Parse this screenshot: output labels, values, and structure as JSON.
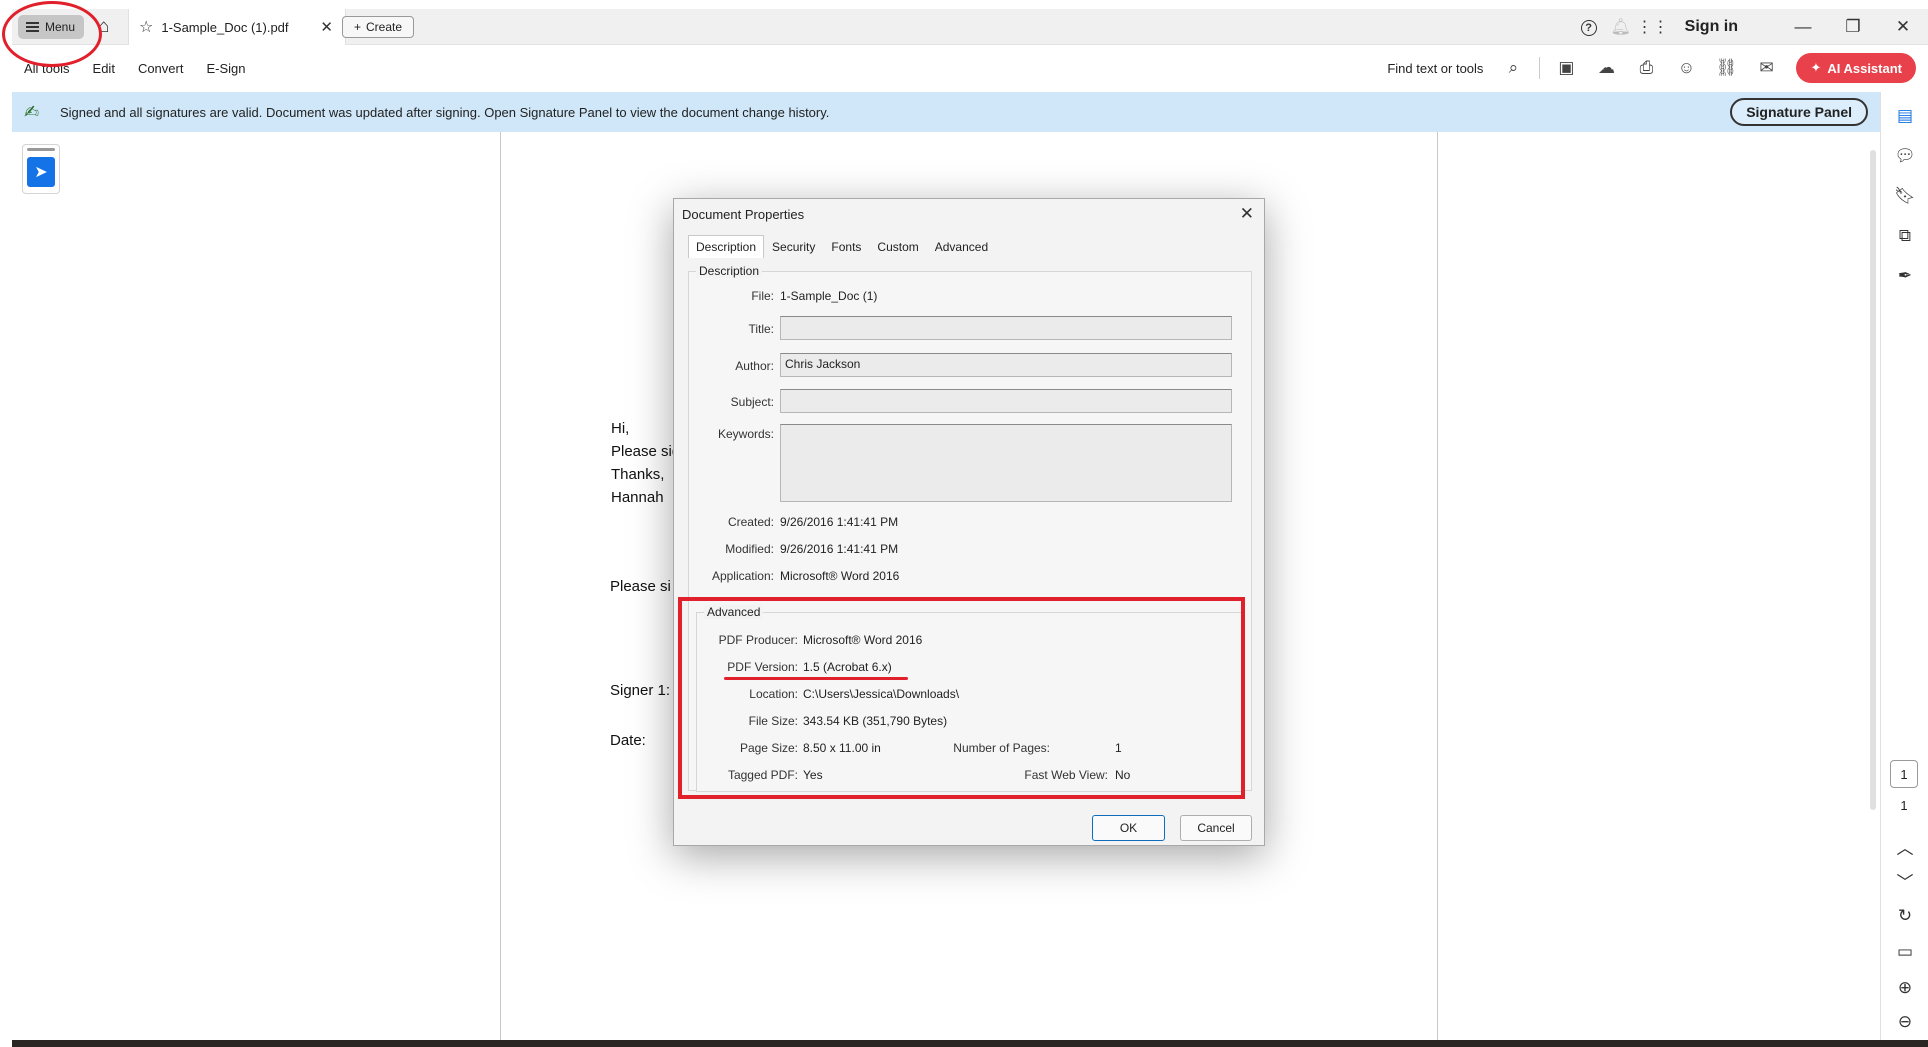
{
  "titlebar": {
    "menu_label": "Menu",
    "tab_title": "1-Sample_Doc (1).pdf",
    "create_label": "Create",
    "sign_in": "Sign in"
  },
  "toolbar": {
    "menu_items": [
      "All tools",
      "Edit",
      "Convert",
      "E-Sign"
    ],
    "find_label": "Find text or tools",
    "ai_assistant": "AI Assistant"
  },
  "banner": {
    "message": "Signed and all signatures are valid. Document was updated after signing. Open Signature Panel to view the document change history.",
    "button": "Signature Panel"
  },
  "document": {
    "lines": [
      "Hi,",
      "Please sig",
      "Thanks,",
      "Hannah"
    ],
    "please_sign": "Please si",
    "signer": "Signer 1:",
    "date": "Date:"
  },
  "dialog": {
    "title": "Document Properties",
    "tabs": [
      "Description",
      "Security",
      "Fonts",
      "Custom",
      "Advanced"
    ],
    "description_group": "Description",
    "file_label": "File:",
    "file_value": "1-Sample_Doc (1)",
    "title_label": "Title:",
    "title_value": "",
    "author_label": "Author:",
    "author_value": "Chris Jackson",
    "subject_label": "Subject:",
    "subject_value": "",
    "keywords_label": "Keywords:",
    "keywords_value": "",
    "created_label": "Created:",
    "created_value": "9/26/2016 1:41:41 PM",
    "modified_label": "Modified:",
    "modified_value": "9/26/2016 1:41:41 PM",
    "application_label": "Application:",
    "application_value": "Microsoft® Word 2016",
    "advanced_group": "Advanced",
    "producer_label": "PDF Producer:",
    "producer_value": "Microsoft® Word 2016",
    "version_label": "PDF Version:",
    "version_value": "1.5 (Acrobat 6.x)",
    "location_label": "Location:",
    "location_value": "C:\\Users\\Jessica\\Downloads\\",
    "filesize_label": "File Size:",
    "filesize_value": "343.54 KB (351,790 Bytes)",
    "pagesize_label": "Page Size:",
    "pagesize_value": "8.50 x 11.00 in",
    "numpages_label": "Number of Pages:",
    "numpages_value": "1",
    "tagged_label": "Tagged PDF:",
    "tagged_value": "Yes",
    "fastweb_label": "Fast Web View:",
    "fastweb_value": "No",
    "ok": "OK",
    "cancel": "Cancel"
  },
  "pagenav": {
    "current": "1",
    "total": "1"
  },
  "colors": {
    "accent": "#1473e6",
    "ai_button": "#e8414b",
    "banner_bg": "#cfe7f8",
    "annotation": "#e0202b"
  }
}
